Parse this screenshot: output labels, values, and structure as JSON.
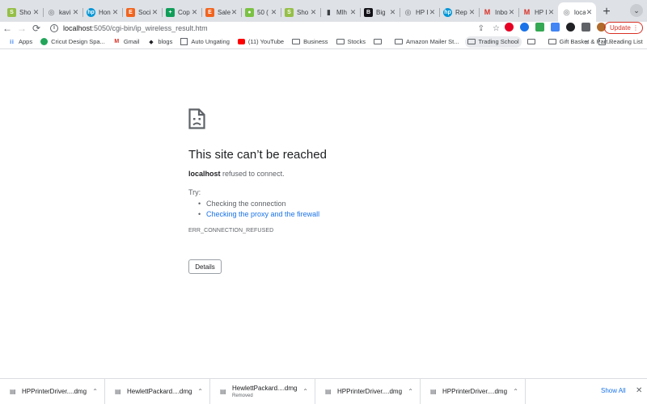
{
  "tabs": [
    {
      "title": "Sho",
      "icon": "shopify-icon",
      "color": "#95bf47"
    },
    {
      "title": "kavi",
      "icon": "globe-icon",
      "color": "#5f6368"
    },
    {
      "title": "Hon",
      "icon": "hp-icon",
      "color": "#0096d6"
    },
    {
      "title": "Soci",
      "icon": "etsy-icon",
      "color": "#f1641e"
    },
    {
      "title": "Cop",
      "icon": "sheets-icon",
      "color": "#0f9d58"
    },
    {
      "title": "Sale",
      "icon": "etsy-icon",
      "color": "#f1641e"
    },
    {
      "title": "50 (",
      "icon": "app-icon",
      "color": "#7ac143"
    },
    {
      "title": "Sho",
      "icon": "shopify-icon",
      "color": "#95bf47"
    },
    {
      "title": "Mlh",
      "icon": "chart-icon",
      "color": "#3c4043"
    },
    {
      "title": "Big",
      "icon": "bigcommerce-icon",
      "color": "#121118"
    },
    {
      "title": "HP I",
      "icon": "globe-icon",
      "color": "#5f6368"
    },
    {
      "title": "Rep",
      "icon": "hp-icon",
      "color": "#0096d6"
    },
    {
      "title": "Inbo",
      "icon": "gmail-icon",
      "color": "#d93025"
    },
    {
      "title": "HP I",
      "icon": "gmail-icon",
      "color": "#d93025"
    },
    {
      "title": "loca",
      "icon": "globe-icon",
      "color": "#5f6368",
      "active": true
    }
  ],
  "toolbar": {
    "url_host": "localhost",
    "url_path": ":5050/cgi-bin/ip_wireless_result.htm",
    "update_label": "Update"
  },
  "bookmarks": {
    "items": [
      {
        "label": "Apps",
        "icon": "apps-grid-icon"
      },
      {
        "label": "Cricut Design Spa...",
        "icon": "cricut-icon"
      },
      {
        "label": "Gmail",
        "icon": "gmail-icon"
      },
      {
        "label": "blogs",
        "icon": "bookmark-icon"
      },
      {
        "label": "Auto Ungating",
        "icon": "page-icon"
      },
      {
        "label": "(11) YouTube",
        "icon": "youtube-icon"
      },
      {
        "label": "Business",
        "icon": "folder-icon"
      },
      {
        "label": "Stocks",
        "icon": "folder-icon"
      },
      {
        "label": "",
        "icon": "folder-icon"
      },
      {
        "label": "Amazon Mailer St...",
        "icon": "folder-icon"
      },
      {
        "label": "Trading School",
        "icon": "folder-icon",
        "highlight": true
      },
      {
        "label": "",
        "icon": "folder-icon"
      },
      {
        "label": "Gift Basket & Part...",
        "icon": "folder-icon"
      }
    ],
    "reading_list": "Reading List"
  },
  "error": {
    "title": "This site can’t be reached",
    "host": "localhost",
    "summary_rest": " refused to connect.",
    "try_label": "Try:",
    "suggestions": [
      {
        "text": "Checking the connection",
        "link": false
      },
      {
        "text": "Checking the proxy and the firewall",
        "link": true
      }
    ],
    "code": "ERR_CONNECTION_REFUSED",
    "details_label": "Details"
  },
  "downloads": {
    "items": [
      {
        "name": "HPPrinterDriver....dmg",
        "status": ""
      },
      {
        "name": "HewlettPackard....dmg",
        "status": ""
      },
      {
        "name": "HewlettPackard....dmg",
        "status": "Removed"
      },
      {
        "name": "HPPrinterDriver....dmg",
        "status": ""
      },
      {
        "name": "HPPrinterDriver....dmg",
        "status": ""
      }
    ],
    "show_all": "Show All"
  }
}
